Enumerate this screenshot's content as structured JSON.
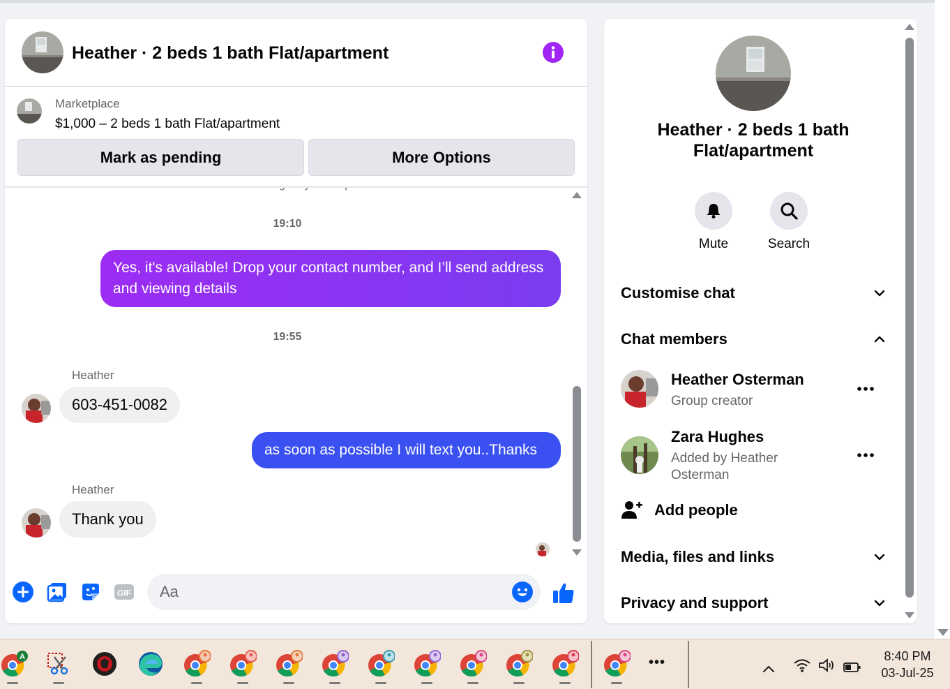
{
  "chat": {
    "title": "Heather · 2 beds 1 bath Flat/apartment",
    "marketplace_label": "Marketplace",
    "listing": "$1,000 – 2 beds 1 bath Flat/apartment",
    "mark_pending_label": "Mark as pending",
    "more_options_label": "More Options",
    "waiting_notice": "Heather is waiting for your response.",
    "messages": [
      {
        "type": "timestamp",
        "text": "19:10"
      },
      {
        "type": "outgoing",
        "text": "Yes, it's available! Drop your contact number, and I’ll send address and viewing details"
      },
      {
        "type": "timestamp",
        "text": "19:55"
      },
      {
        "type": "incoming",
        "sender": "Heather",
        "text": "603-451-0082"
      },
      {
        "type": "outgoing",
        "text": "as soon as possible I will text you..Thanks"
      },
      {
        "type": "incoming",
        "sender": "Heather",
        "text": "Thank you"
      }
    ],
    "composer": {
      "placeholder": "Aa",
      "icons": [
        "plus-circle-icon",
        "photo-icon",
        "sticker-icon",
        "gif-icon",
        "emoji-icon",
        "thumbs-up-icon"
      ],
      "gif_label": "GIF"
    }
  },
  "panel": {
    "title": "Heather · 2 beds 1 bath Flat/apartment",
    "actions": [
      {
        "label": "Mute",
        "icon": "bell-icon"
      },
      {
        "label": "Search",
        "icon": "search-icon"
      }
    ],
    "sections": {
      "customise": "Customise chat",
      "members": "Chat members",
      "media": "Media, files and links",
      "privacy": "Privacy and support"
    },
    "members": [
      {
        "name": "Heather Osterman",
        "subtitle": "Group creator"
      },
      {
        "name": "Zara Hughes",
        "subtitle": "Added by Heather Osterman"
      }
    ],
    "add_people_label": "Add people"
  },
  "taskbar": {
    "apps": [
      "chrome-profile-a",
      "snipping-tool",
      "game-app",
      "edge",
      "chrome-profile-1",
      "chrome-profile-2",
      "chrome-profile-3",
      "chrome-profile-4",
      "chrome-profile-5",
      "chrome-profile-6",
      "chrome-profile-7",
      "chrome-profile-8",
      "chrome-profile-9",
      "chrome-profile-10"
    ],
    "overflow_label": "•••",
    "chrome_badge_letter": "A",
    "clock": {
      "time": "8:40 PM",
      "date": "03-Jul-25"
    }
  },
  "colors": {
    "accent_purple": "#9c2cf3",
    "outgoing_blue": "#3a50f0",
    "messenger_blue": "#0866ff",
    "panel_bg": "#f0f2f5"
  }
}
